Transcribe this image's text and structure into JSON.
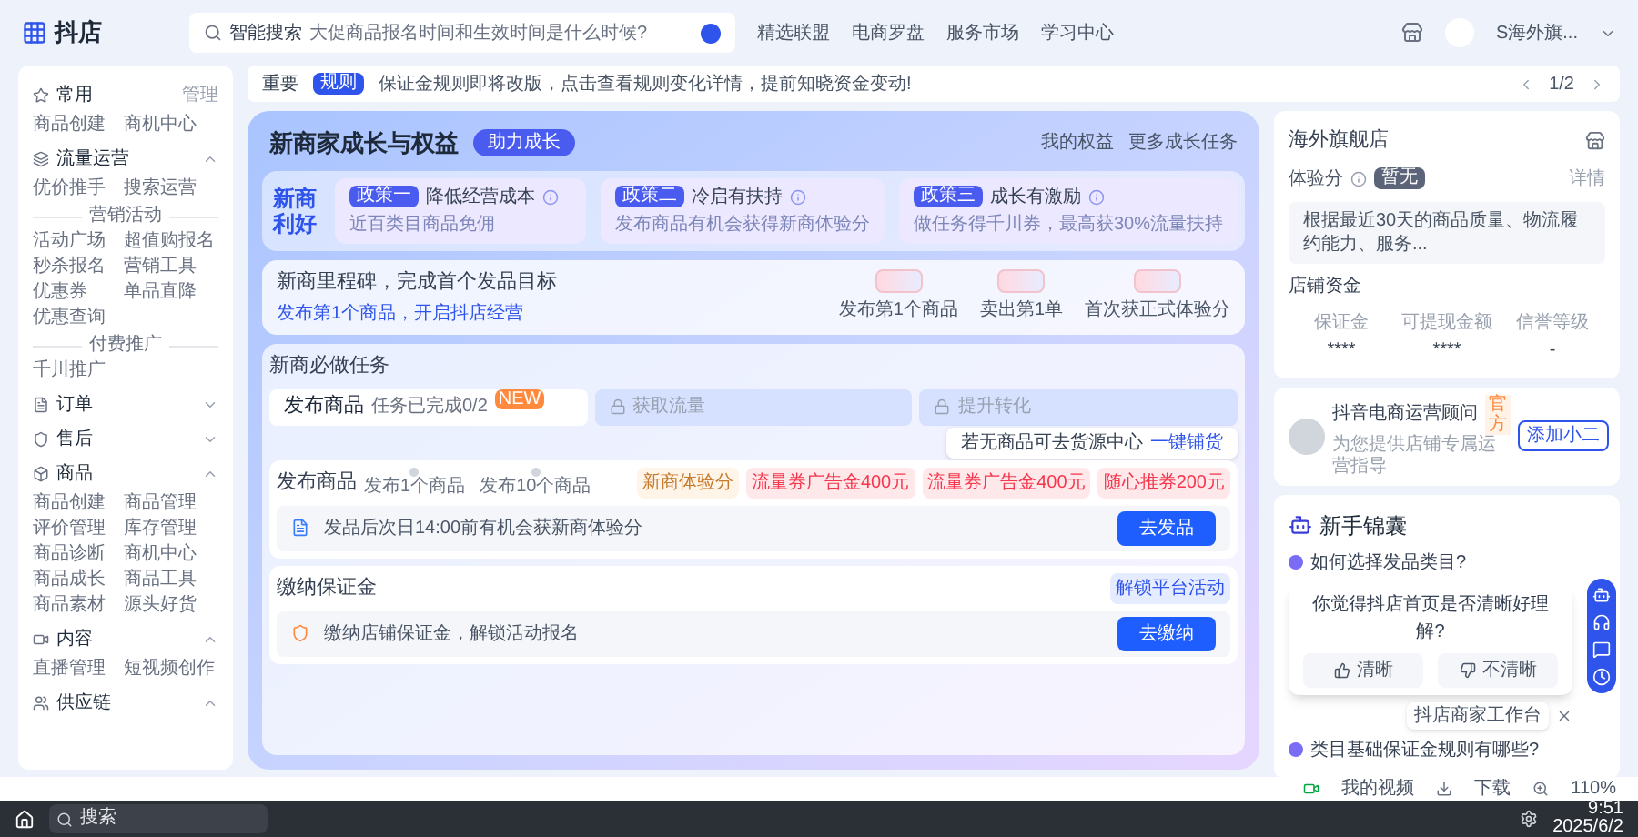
{
  "topbar": {
    "logo": "抖店",
    "search": {
      "label": "智能搜索",
      "placeholder": "大促商品报名时间和生效时间是什么时候?"
    },
    "nav": [
      "精选联盟",
      "电商罗盘",
      "服务市场",
      "学习中心"
    ],
    "user": "S海外旗..."
  },
  "sidebar": [
    {
      "title": "常用",
      "action": "管理",
      "sections": [
        {
          "items": [
            "商品创建",
            "商机中心"
          ]
        }
      ]
    },
    {
      "title": "流量运营",
      "expanded": true,
      "sections": [
        {
          "items": [
            "优价推手",
            "搜索运营"
          ]
        },
        {
          "heading": "营销活动",
          "items": [
            "活动广场",
            "超值购报名",
            "秒杀报名",
            "营销工具",
            "优惠券",
            "单品直降",
            "优惠查询"
          ]
        },
        {
          "heading": "付费推广",
          "items": [
            "千川推广"
          ]
        }
      ]
    },
    {
      "title": "订单",
      "expanded": false
    },
    {
      "title": "售后",
      "expanded": false
    },
    {
      "title": "商品",
      "expanded": true,
      "sections": [
        {
          "items": [
            "商品创建",
            "商品管理",
            "评价管理",
            "库存管理",
            "商品诊断",
            "商机中心",
            "商品成长",
            "商品工具",
            "商品素材",
            "源头好货"
          ]
        }
      ]
    },
    {
      "title": "内容",
      "expanded": true,
      "sections": [
        {
          "items": [
            "直播管理",
            "短视频创作"
          ]
        }
      ]
    },
    {
      "title": "供应链",
      "expanded": true
    }
  ],
  "notice": {
    "label": "重要",
    "tag": "规则",
    "text": "保证金规则即将改版，点击查看规则变化详情，提前知晓资金变动!",
    "pager": "1/2"
  },
  "growth": {
    "title": "新商家成长与权益",
    "badge": "助力成长",
    "links": [
      "我的权益",
      "更多成长任务"
    ],
    "benefits_label": "新商利好",
    "benefits": [
      {
        "tag": "政策一",
        "title": "降低经营成本",
        "desc": "近百类目商品免佣"
      },
      {
        "tag": "政策二",
        "title": "冷启有扶持",
        "desc": "发布商品有机会获得新商体验分"
      },
      {
        "tag": "政策三",
        "title": "成长有激励",
        "desc": "做任务得千川券，最高获30%流量扶持"
      }
    ],
    "milestone": {
      "title": "新商里程碑，完成首个发品目标",
      "link": "发布第1个商品，开启抖店经营",
      "steps": [
        "发布第1个商品",
        "卖出第1单",
        "首次获正式体验分"
      ]
    },
    "tasks": {
      "title": "新商必做任务",
      "steps": [
        {
          "label": "发布商品",
          "status": "任务已完成0/2",
          "badge": "NEW",
          "selected": true
        },
        {
          "label": "获取流量",
          "selected": false
        },
        {
          "label": "提升转化",
          "selected": false
        }
      ],
      "items": [
        {
          "title": "发布商品",
          "progress": [
            "发布1个商品",
            "发布10个商品"
          ],
          "rewards": [
            "新商体验分",
            "流量券广告金400元",
            "流量券广告金400元",
            "随心推券200元"
          ],
          "tip": "发品后次日14:00前有机会获新商体验分",
          "button": "去发品",
          "kind": "publish"
        },
        {
          "title": "缴纳保证金",
          "rewards": [
            "解锁平台活动"
          ],
          "tip": "缴纳店铺保证金，解锁活动报名",
          "button": "去缴纳",
          "kind": "deposit"
        }
      ],
      "hint": {
        "text": "若无商品可去货源中心",
        "link": "一键铺货"
      }
    }
  },
  "store": {
    "name": "海外旗舰店",
    "score_label": "体验分",
    "score_tag": "暂无",
    "detail": "详情",
    "desc": "根据最近30天的商品质量、物流履约能力、服务...",
    "funds_title": "店铺资金",
    "funds": [
      {
        "label": "保证金",
        "value": "****"
      },
      {
        "label": "可提现金额",
        "value": "****"
      },
      {
        "label": "信誉等级",
        "value": "-"
      }
    ]
  },
  "advisor": {
    "name": "抖音电商运营顾问",
    "tag": "官方",
    "desc": "为您提供店铺专属运营指导",
    "button": "添加小二"
  },
  "guide": {
    "title": "新手锦囊",
    "questions": [
      "如何选择发品类目?",
      "类目基础保证金规则有哪些?"
    ]
  },
  "survey": {
    "question": "你觉得抖店首页是否清晰好理解?",
    "options": [
      "清晰",
      "不清晰"
    ]
  },
  "float_tip": "抖店商家工作台",
  "statusbar": {
    "items": [
      "我的视频",
      "下载"
    ],
    "zoom": "110%"
  },
  "taskbar": {
    "search": "搜索",
    "time": "9:51",
    "date": "2025/6/2"
  }
}
